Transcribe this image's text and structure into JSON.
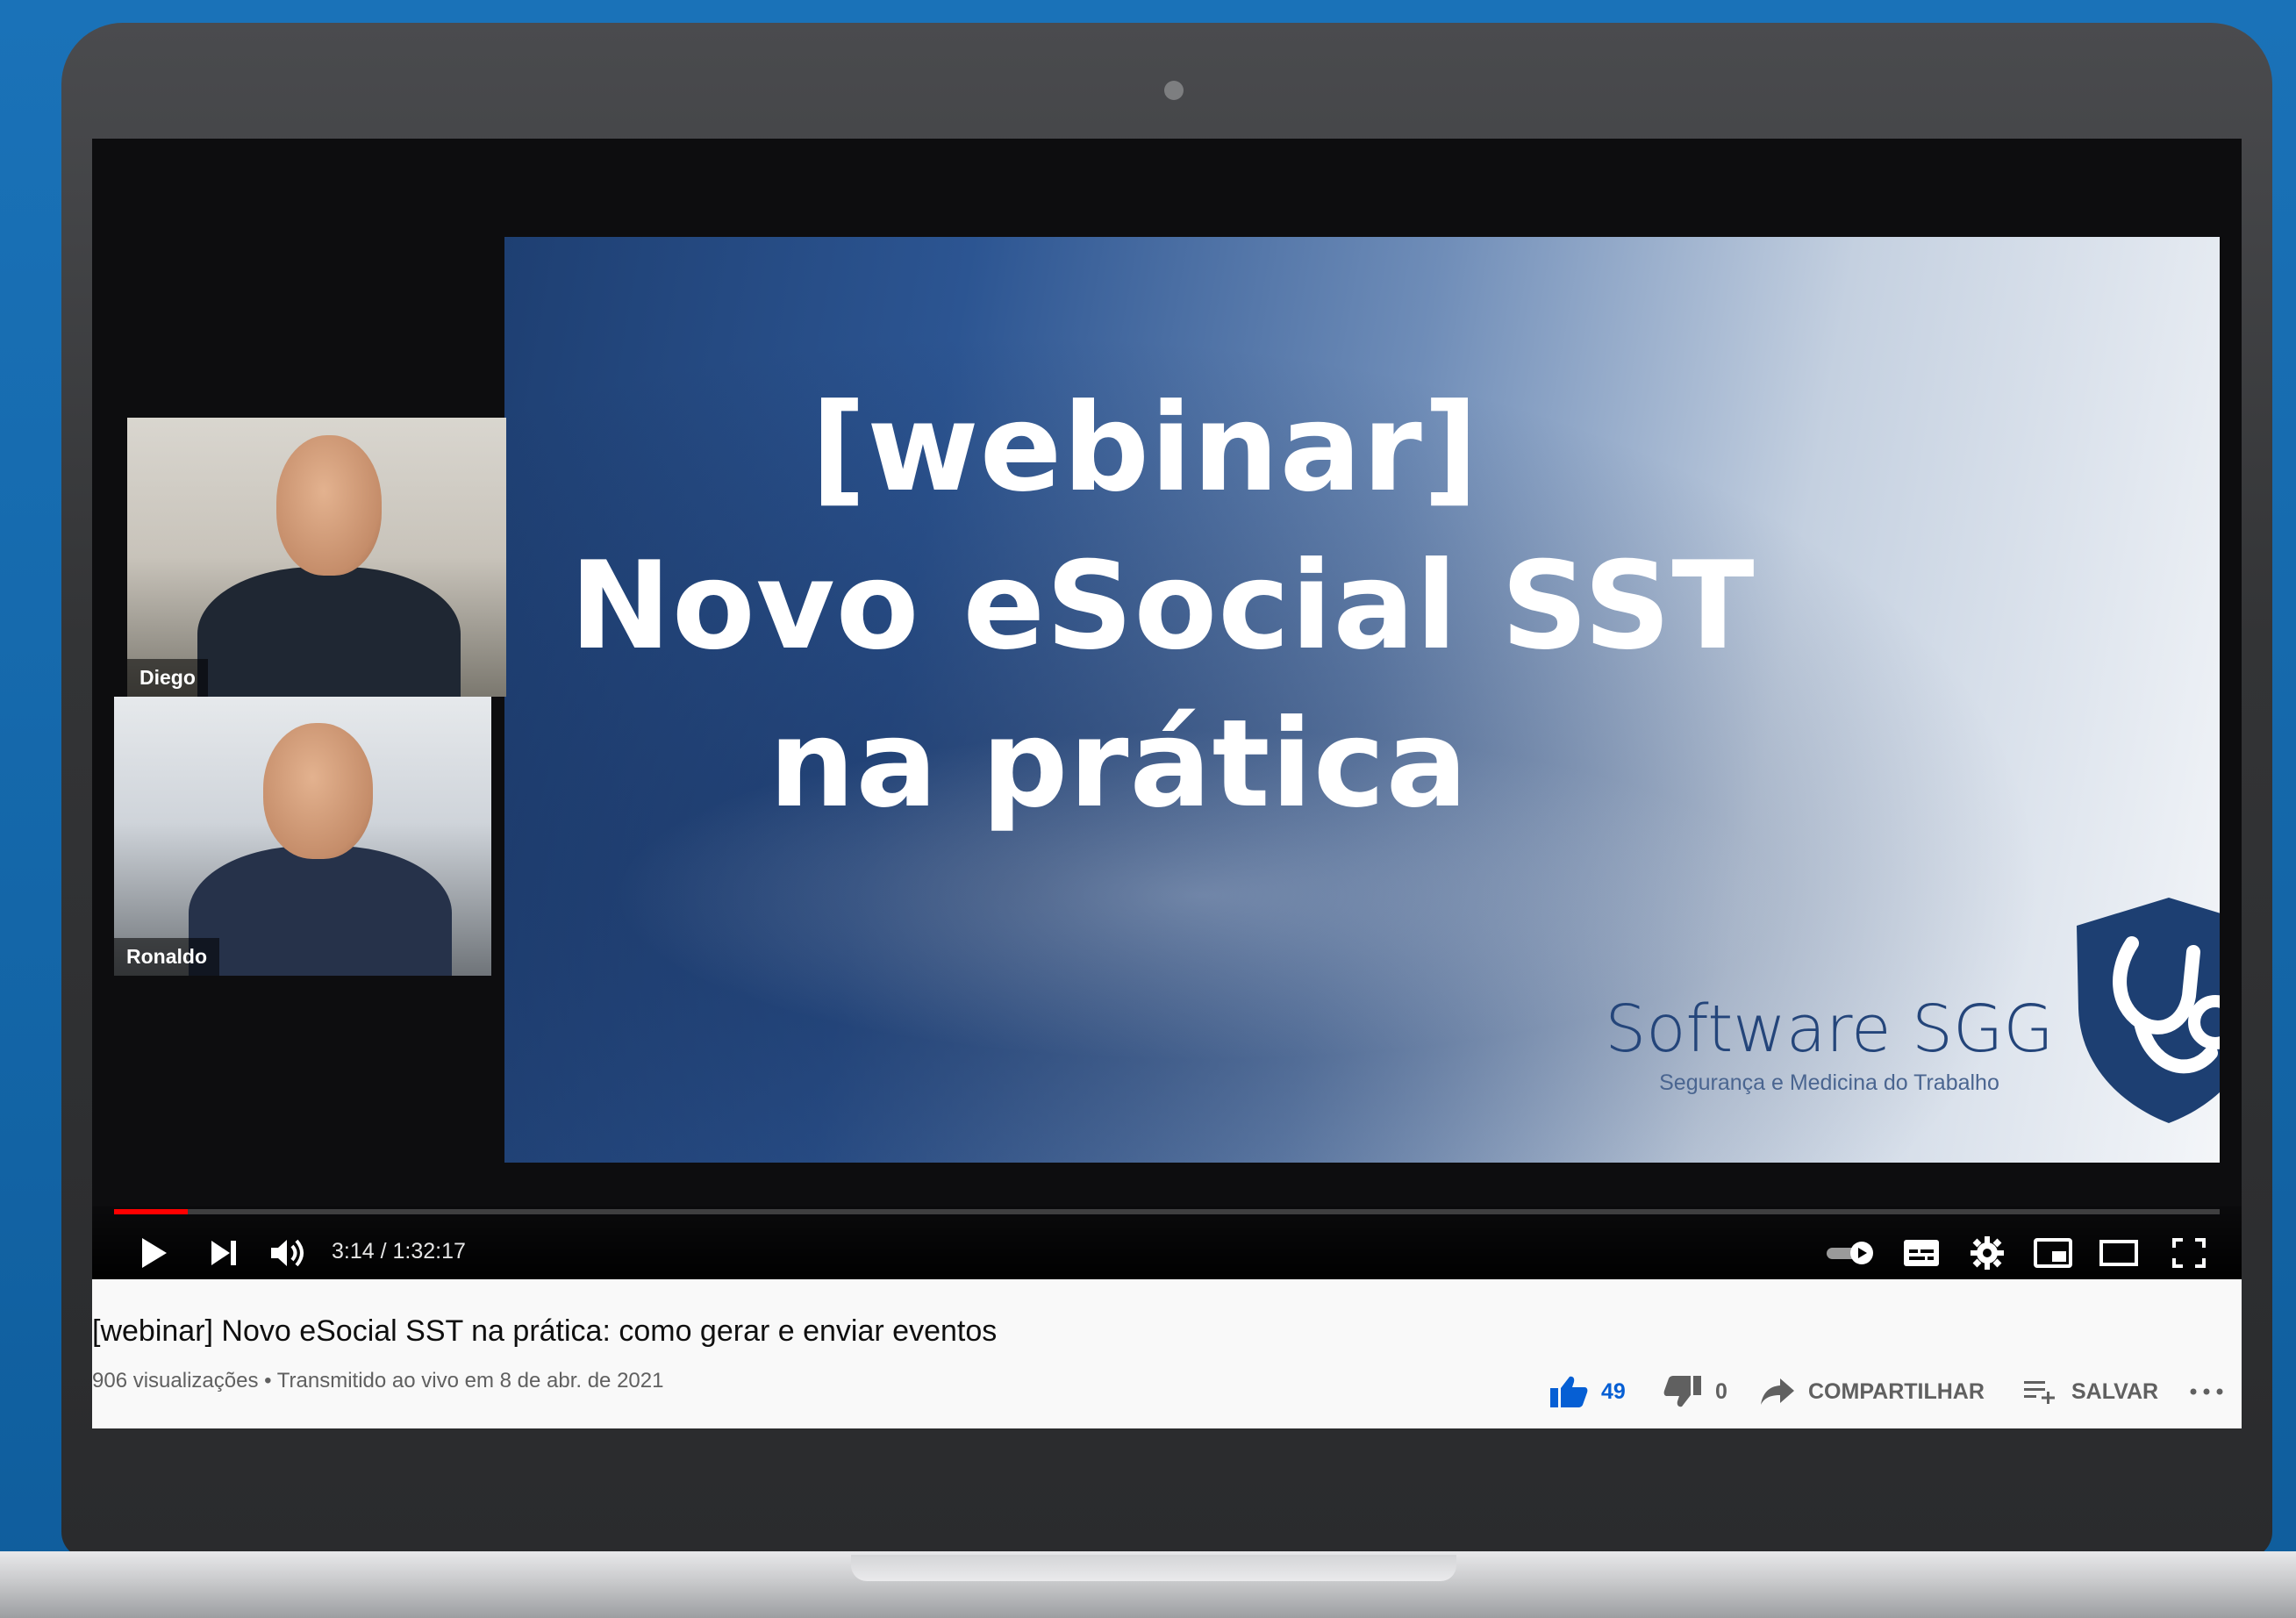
{
  "slide": {
    "line1": "[webinar]",
    "line2": "Novo eSocial SST",
    "line3": "na prática",
    "brand_name": "Software SGG",
    "brand_tagline": "Segurança e Medicina do Trabalho"
  },
  "participants": [
    {
      "name": "Diego"
    },
    {
      "name": "Ronaldo"
    }
  ],
  "player": {
    "current_time": "3:14",
    "separator": " / ",
    "duration": "1:32:17",
    "progress_fraction": 0.035,
    "icons": {
      "play": "play-icon",
      "next": "next-icon",
      "volume": "volume-icon",
      "autoplay": "autoplay-toggle-icon",
      "subtitles": "subtitles-icon",
      "settings": "gear-icon",
      "miniplayer": "miniplayer-icon",
      "theater": "theater-mode-icon",
      "fullscreen": "fullscreen-icon"
    }
  },
  "video": {
    "title": "[webinar] Novo eSocial SST na prática: como gerar e enviar eventos",
    "views": "906 visualizações",
    "meta_sep": " • ",
    "streamed": "Transmitido ao vivo em 8 de abr. de 2021"
  },
  "actions": {
    "likes": "49",
    "dislikes": "0",
    "share_label": "COMPARTILHAR",
    "save_label": "SALVAR"
  },
  "colors": {
    "background": "#1a72b8",
    "progress": "#ff0000",
    "like_accent": "#065fd4"
  }
}
